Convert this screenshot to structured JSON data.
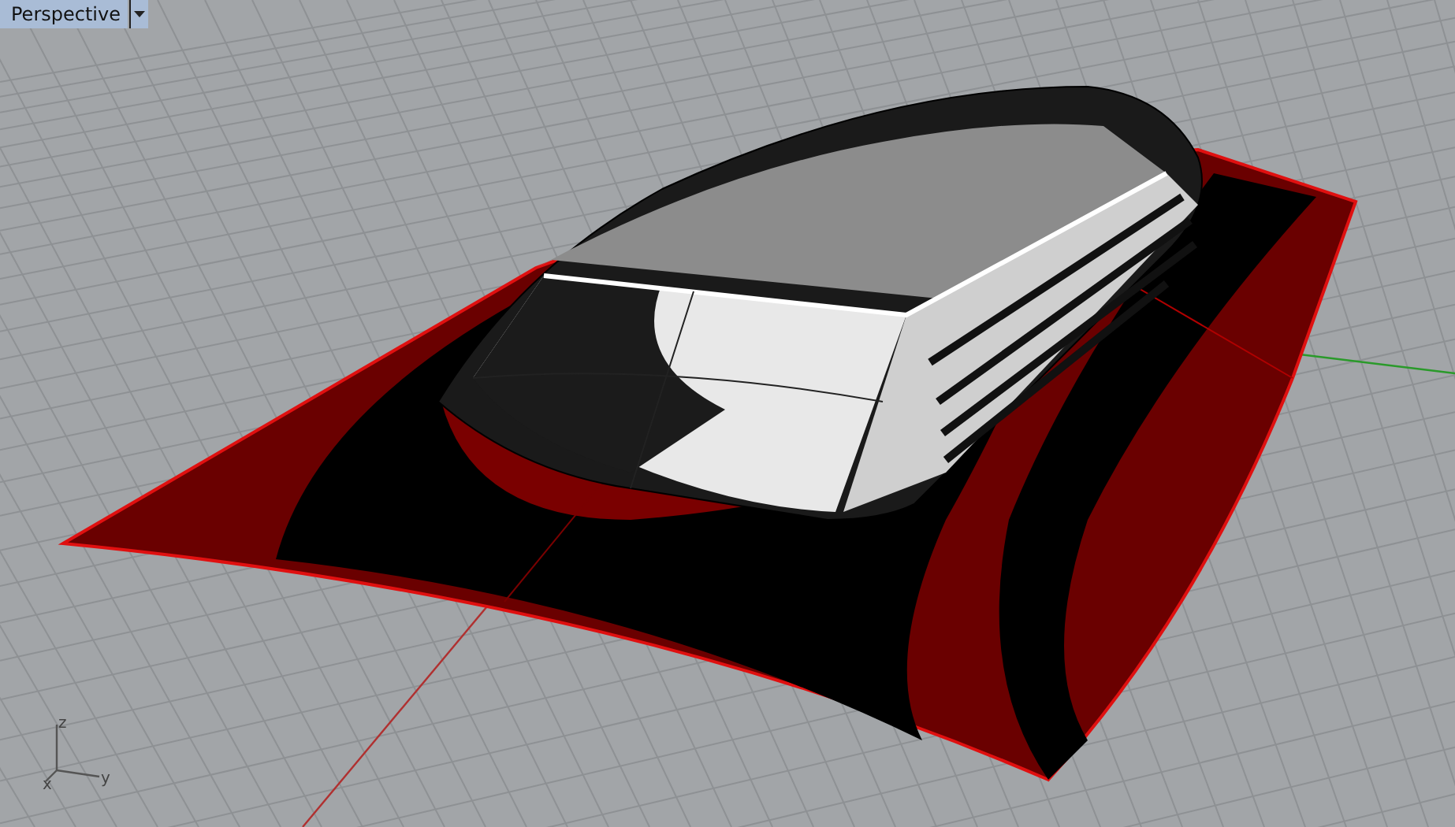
{
  "viewport": {
    "title": "Perspective"
  },
  "axis_labels": [
    {
      "kind": "z",
      "text": "z"
    },
    {
      "kind": "y",
      "text": "y"
    },
    {
      "kind": "x",
      "text": "x"
    }
  ]
}
